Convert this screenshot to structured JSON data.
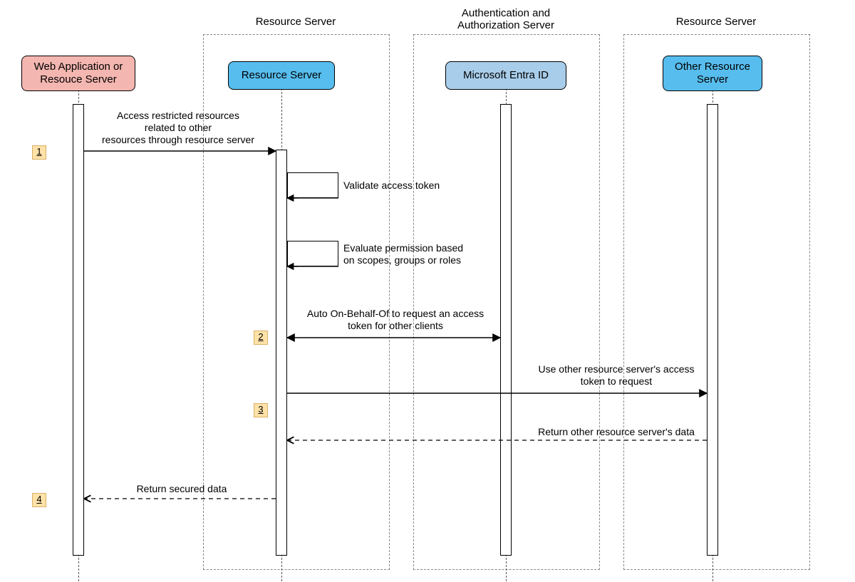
{
  "groups": {
    "resource_server_left": "Resource Server",
    "auth_server": "Authentication and\nAuthorization Server",
    "resource_server_right": "Resource Server"
  },
  "participants": {
    "client": "Web Application or\nResouce Server",
    "rs": "Resource Server",
    "auth": "Microsoft Entra ID",
    "other_rs": "Other Resource\nServer"
  },
  "steps": {
    "n1": "1",
    "n2": "2",
    "n3": "3",
    "n4": "4"
  },
  "messages": {
    "m1": "Access restricted resources\nrelated to other\nresources through resource server",
    "m_self1": "Validate access token",
    "m_self2": "Evaluate permission based\non scopes, groups or roles",
    "m2": "Auto On-Behalf-Of to request an access\ntoken for other clients",
    "m3": "Use other resource server's access\ntoken to request",
    "m_ret_other": "Return other resource server's data",
    "m_ret_client": "Return secured data"
  }
}
